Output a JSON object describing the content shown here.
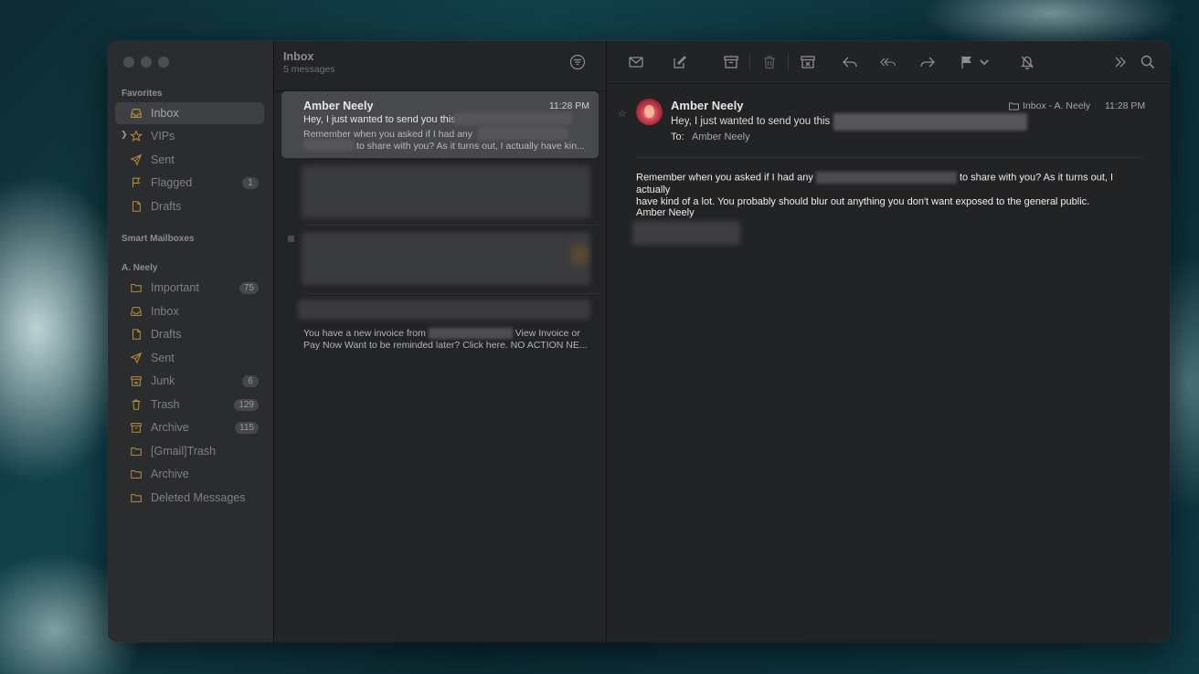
{
  "sidebar": {
    "sections": {
      "favorites": "Favorites",
      "smart": "Smart Mailboxes",
      "account": "A. Neely"
    },
    "favorites": [
      {
        "label": "Inbox",
        "icon": "inbox-icon",
        "badge": ""
      },
      {
        "label": "VIPs",
        "icon": "star-icon",
        "badge": ""
      },
      {
        "label": "Sent",
        "icon": "paper-plane-icon",
        "badge": ""
      },
      {
        "label": "Flagged",
        "icon": "flag-icon",
        "badge": "1"
      },
      {
        "label": "Drafts",
        "icon": "document-icon",
        "badge": ""
      }
    ],
    "account_items": [
      {
        "label": "Important",
        "icon": "folder-icon",
        "badge": "75"
      },
      {
        "label": "Inbox",
        "icon": "inbox-icon",
        "badge": ""
      },
      {
        "label": "Drafts",
        "icon": "document-icon",
        "badge": ""
      },
      {
        "label": "Sent",
        "icon": "paper-plane-icon",
        "badge": ""
      },
      {
        "label": "Junk",
        "icon": "junk-icon",
        "badge": "6"
      },
      {
        "label": "Trash",
        "icon": "trash-icon",
        "badge": "129"
      },
      {
        "label": "Archive",
        "icon": "archive-icon",
        "badge": "115"
      },
      {
        "label": "[Gmail]Trash",
        "icon": "folder-icon",
        "badge": ""
      },
      {
        "label": "Archive",
        "icon": "folder-icon",
        "badge": ""
      },
      {
        "label": "Deleted Messages",
        "icon": "folder-icon",
        "badge": ""
      }
    ]
  },
  "list": {
    "title": "Inbox",
    "count": "5 messages",
    "selected": {
      "sender": "Amber Neely",
      "time": "11:28 PM",
      "subject": "Hey, I just wanted to send you this",
      "preview1": "Remember when you asked if I had any",
      "preview2": "to share with you? As it turns out, I actually have kin..."
    },
    "invoice": {
      "line1": "You have a new invoice from",
      "line1b": "View Invoice or",
      "line2": "Pay Now Want to be reminded later? Click here. NO ACTION NE..."
    }
  },
  "reader": {
    "sender": "Amber Neely",
    "subject": "Hey, I just wanted to send you this",
    "to_label": "To:",
    "to": "Amber Neely",
    "mailbox": "Inbox - A. Neely",
    "time": "11:28 PM",
    "body_a": "Remember when you asked if I had any",
    "body_b": "to share with you? As it turns out, I actually",
    "body_c": "have kind of a lot. You probably should blur out anything you don't want exposed to the general public.",
    "signature": "Amber Neely"
  },
  "colors": {
    "window_bg": "#242527",
    "sidebar_bg": "#2b2c2e",
    "selected_row": "#48494c",
    "favorites_icon_accent": "#b58a3a"
  }
}
